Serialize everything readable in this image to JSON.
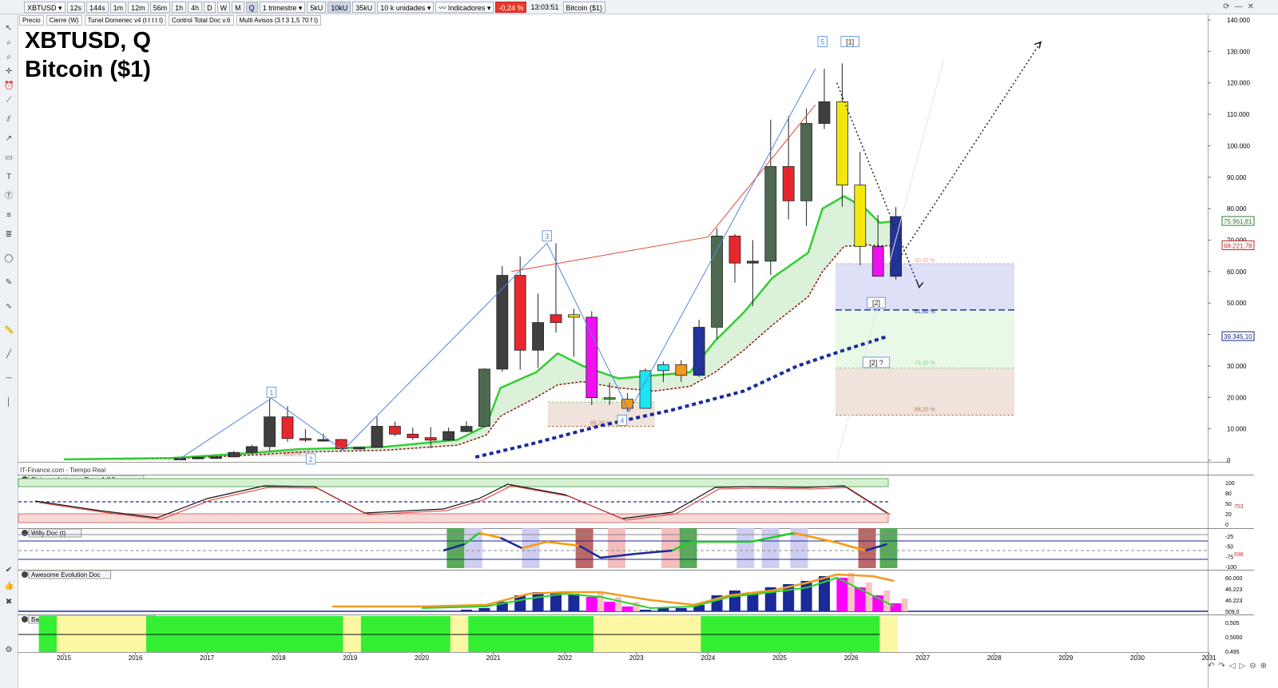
{
  "toolbar": {
    "symbol": "XBTUSD",
    "timeframes": [
      "12s",
      "144s",
      "1m",
      "12m",
      "56m",
      "1h",
      "4h",
      "D",
      "W",
      "M",
      "Q"
    ],
    "active_timeframe": "Q",
    "period": "1 trimestre",
    "volume_modes": [
      "5kU",
      "10kU",
      "35kU"
    ],
    "active_volume": "10kU",
    "units": "10 k unidades",
    "indicators_label": "Indicadores",
    "change_pct": "-0,24 %",
    "time": "13:03:51",
    "instrument_name": "Bitcoin ($1)"
  },
  "indicators": [
    "Precio",
    "Cierre (W)",
    "Tunel Domenec v4 (t t t t t)",
    "Control Total Doc v.6",
    "Multi Avisos (3 f 3 1,5 70 f t)"
  ],
  "title": {
    "line1": "XBTUSD, Q",
    "line2": "Bitcoin ($1)"
  },
  "source": "IT-Finance.com - Tiempo Real",
  "price_axis": {
    "labels": [
      "140.000",
      "130.000",
      "120.000",
      "110.000",
      "100.000",
      "90.000",
      "80.000",
      "70.000",
      "60.000",
      "50.000",
      "40.000",
      "30.000",
      "20.000",
      "10.000",
      "0"
    ],
    "tags": [
      {
        "text": "75.961,81",
        "color": "#2e7d32"
      },
      {
        "text": "68.221,78",
        "color": "#c62828"
      },
      {
        "text": "39.345,10",
        "color": "#1a237e"
      }
    ]
  },
  "years": [
    "2015",
    "2016",
    "2017",
    "2018",
    "2019",
    "2020",
    "2021",
    "2022",
    "2023",
    "2024",
    "2025",
    "2026",
    "2027",
    "2028",
    "2029",
    "2030",
    "2031"
  ],
  "fib": {
    "right": [
      "50,00 %",
      "61,80 %",
      "76,40 %",
      "88,20 %"
    ],
    "left": [
      "76,40 %",
      "88,20 %"
    ],
    "left_small": "88,20 %"
  },
  "waves": [
    "1",
    "2",
    "3",
    "4",
    "5",
    "[1]",
    "[2]",
    "[2] ?"
  ],
  "panels": [
    {
      "name": "Sistema de trenes Doc v4 (f f)",
      "axis": [
        "100",
        "80",
        "50",
        "20",
        "0"
      ],
      "value": "753"
    },
    {
      "name": "Willy Doc (t)",
      "axis": [
        "-25",
        "-50",
        "-75",
        "-100"
      ],
      "value": "698"
    },
    {
      "name": "Awesome Evolution Doc",
      "axis": [
        "60.000",
        "46.223",
        "46.223",
        "509,0"
      ]
    },
    {
      "name": "Barra Fuerza Fondo Mercado v4 (f)",
      "axis": [
        "0,505",
        "0,5000",
        "0,495"
      ]
    }
  ],
  "chart_data": {
    "type": "candlestick",
    "timeframe": "Q",
    "ylim": [
      0,
      140000
    ],
    "candles": [
      {
        "t": "2016Q3",
        "o": 570,
        "h": 760,
        "l": 480,
        "c": 610
      },
      {
        "t": "2016Q4",
        "o": 610,
        "h": 980,
        "l": 590,
        "c": 960
      },
      {
        "t": "2017Q1",
        "o": 960,
        "h": 1300,
        "l": 880,
        "c": 1070
      },
      {
        "t": "2017Q2",
        "o": 1070,
        "h": 2980,
        "l": 1000,
        "c": 2490
      },
      {
        "t": "2017Q3",
        "o": 2490,
        "h": 4980,
        "l": 1830,
        "c": 4350
      },
      {
        "t": "2017Q4",
        "o": 4350,
        "h": 19700,
        "l": 2970,
        "c": 13800
      },
      {
        "t": "2018Q1",
        "o": 13800,
        "h": 17200,
        "l": 5900,
        "c": 6930
      },
      {
        "t": "2018Q2",
        "o": 6930,
        "h": 9900,
        "l": 5800,
        "c": 6400
      },
      {
        "t": "2018Q3",
        "o": 6400,
        "h": 8500,
        "l": 5900,
        "c": 6600
      },
      {
        "t": "2018Q4",
        "o": 6600,
        "h": 6800,
        "l": 3150,
        "c": 3700
      },
      {
        "t": "2019Q1",
        "o": 3700,
        "h": 4200,
        "l": 3400,
        "c": 4100
      },
      {
        "t": "2019Q2",
        "o": 4100,
        "h": 13800,
        "l": 4000,
        "c": 10800
      },
      {
        "t": "2019Q3",
        "o": 10800,
        "h": 12300,
        "l": 7700,
        "c": 8300
      },
      {
        "t": "2019Q4",
        "o": 8300,
        "h": 10400,
        "l": 6500,
        "c": 7200
      },
      {
        "t": "2020Q1",
        "o": 7200,
        "h": 10500,
        "l": 3800,
        "c": 6400
      },
      {
        "t": "2020Q2",
        "o": 6400,
        "h": 10400,
        "l": 6200,
        "c": 9130
      },
      {
        "t": "2020Q3",
        "o": 9130,
        "h": 12400,
        "l": 8900,
        "c": 10780
      },
      {
        "t": "2020Q4",
        "o": 10780,
        "h": 29300,
        "l": 10400,
        "c": 28990
      },
      {
        "t": "2021Q1",
        "o": 28990,
        "h": 61800,
        "l": 28100,
        "c": 58800
      },
      {
        "t": "2021Q2",
        "o": 58800,
        "h": 64800,
        "l": 28800,
        "c": 35000
      },
      {
        "t": "2021Q3",
        "o": 35000,
        "h": 53000,
        "l": 29300,
        "c": 43800
      },
      {
        "t": "2021Q4",
        "o": 43800,
        "h": 69000,
        "l": 40600,
        "c": 46300
      },
      {
        "t": "2022Q1",
        "o": 46300,
        "h": 48200,
        "l": 32900,
        "c": 45500
      },
      {
        "t": "2022Q2",
        "o": 45500,
        "h": 47400,
        "l": 17600,
        "c": 19900
      },
      {
        "t": "2022Q3",
        "o": 19900,
        "h": 24700,
        "l": 17600,
        "c": 19400
      },
      {
        "t": "2022Q4",
        "o": 19400,
        "h": 21400,
        "l": 15500,
        "c": 16500
      },
      {
        "t": "2023Q1",
        "o": 16500,
        "h": 29200,
        "l": 16500,
        "c": 28500
      },
      {
        "t": "2023Q2",
        "o": 28500,
        "h": 31400,
        "l": 24800,
        "c": 30400
      },
      {
        "t": "2023Q3",
        "o": 30400,
        "h": 31800,
        "l": 24900,
        "c": 27000
      },
      {
        "t": "2023Q4",
        "o": 27000,
        "h": 44700,
        "l": 26500,
        "c": 42300
      },
      {
        "t": "2024Q1",
        "o": 42300,
        "h": 73800,
        "l": 38500,
        "c": 71300
      },
      {
        "t": "2024Q2",
        "o": 71300,
        "h": 72000,
        "l": 56500,
        "c": 62700
      },
      {
        "t": "2024Q3",
        "o": 62700,
        "h": 70000,
        "l": 49000,
        "c": 63300
      },
      {
        "t": "2024Q4",
        "o": 63300,
        "h": 108300,
        "l": 58900,
        "c": 93400
      },
      {
        "t": "2025Q1",
        "o": 93400,
        "h": 109400,
        "l": 76600,
        "c": 82500
      },
      {
        "t": "2025Q2",
        "o": 82500,
        "h": 111900,
        "l": 74500,
        "c": 107100
      },
      {
        "t": "2025Q3",
        "o": 107100,
        "h": 124500,
        "l": 105300,
        "c": 114000
      },
      {
        "t": "2025Q4",
        "o": 114000,
        "h": 126200,
        "l": 80600,
        "c": 87500
      },
      {
        "t": "2026Q1",
        "o": 87500,
        "h": 98000,
        "l": 62000,
        "c": 68000
      },
      {
        "t": "2026Q2",
        "o": 68000,
        "h": 78000,
        "l": 59000,
        "c": 58500
      },
      {
        "t": "2026Q3",
        "o": 58500,
        "h": 80500,
        "l": 57500,
        "c": 77500
      }
    ],
    "colors": {
      "bull": "#3f3f3f",
      "bear": "#e8272c",
      "yellow": "#f5e70d",
      "magenta": "#f00ff0",
      "navy": "#223399",
      "cyan": "#1fe5f2",
      "green": "#56b24a",
      "orange": "#f29a1e",
      "darkgreen": "#4d6a50"
    }
  }
}
